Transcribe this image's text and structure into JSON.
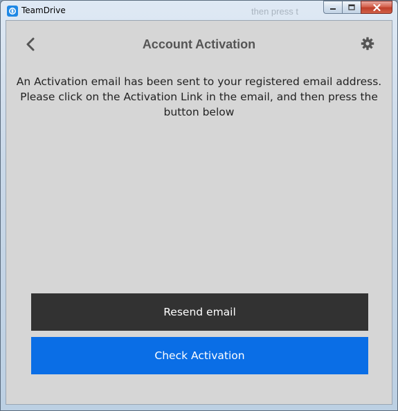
{
  "window": {
    "title": "TeamDrive",
    "background_ghost_text": "then press t"
  },
  "icons": {
    "app": "teamdrive-logo-icon",
    "back": "chevron-left-icon",
    "settings": "gear-icon",
    "minimize": "minimize-icon",
    "maximize": "maximize-icon",
    "close": "close-icon"
  },
  "header": {
    "title": "Account Activation"
  },
  "main": {
    "message": "An Activation email has been sent to your registered email address. Please click on the Activation Link in the email, and then press the button below"
  },
  "actions": {
    "resend_label": "Resend email",
    "check_label": "Check Activation"
  },
  "colors": {
    "resend_bg": "#323232",
    "check_bg": "#0a6ee6",
    "content_bg": "#d6d6d6"
  }
}
